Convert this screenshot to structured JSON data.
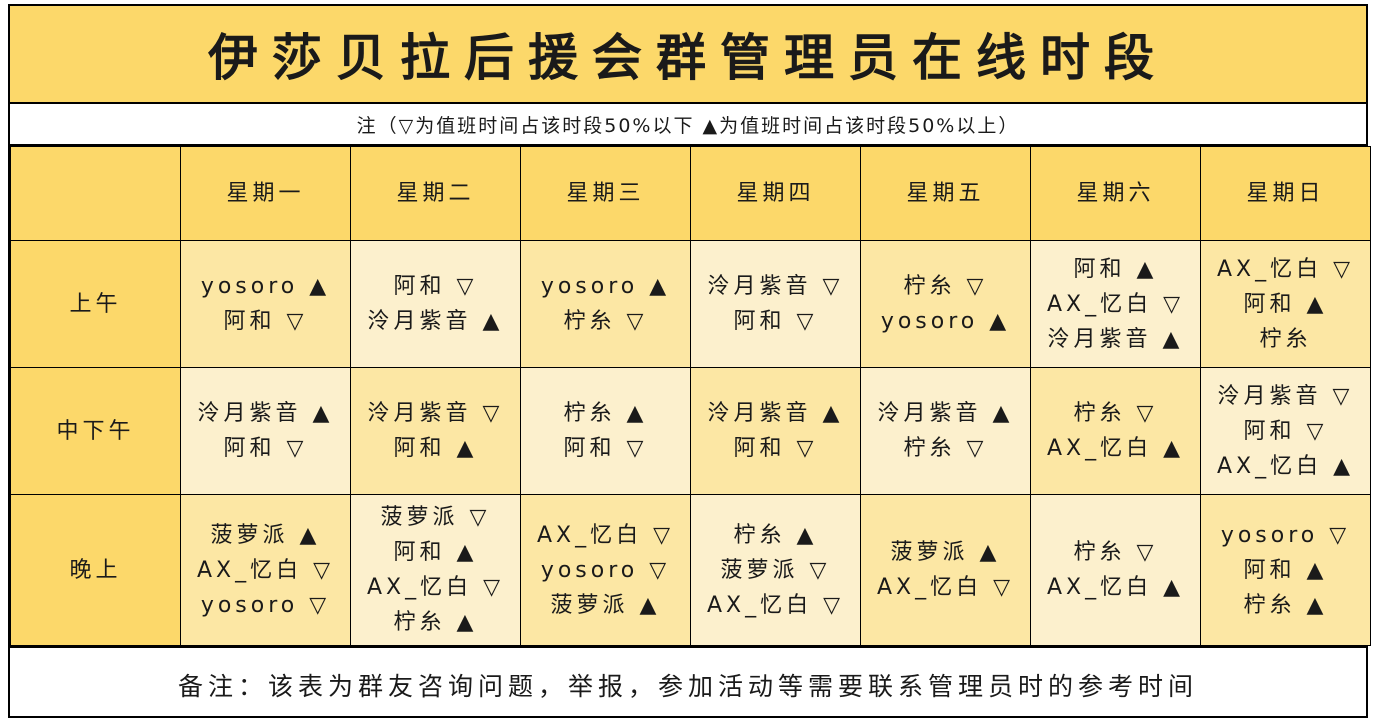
{
  "title": "伊莎贝拉后援会群管理员在线时段",
  "note": "注（▽为值班时间占该时段50%以下 ▲为值班时间占该时段50%以上）",
  "days": [
    "星期一",
    "星期二",
    "星期三",
    "星期四",
    "星期五",
    "星期六",
    "星期日"
  ],
  "periods": [
    {
      "label": "上午",
      "cells": [
        [
          "yosoro ▲",
          "阿和 ▽"
        ],
        [
          "阿和 ▽",
          "泠月紫音 ▲"
        ],
        [
          "yosoro ▲",
          "柠糸 ▽"
        ],
        [
          "泠月紫音 ▽",
          "阿和 ▽"
        ],
        [
          "柠糸 ▽",
          "yosoro ▲"
        ],
        [
          "阿和 ▲",
          "AX_忆白 ▽",
          "泠月紫音 ▲"
        ],
        [
          "AX_忆白 ▽",
          "阿和 ▲",
          "柠糸"
        ]
      ]
    },
    {
      "label": "中下午",
      "cells": [
        [
          "泠月紫音 ▲",
          "阿和 ▽"
        ],
        [
          "泠月紫音 ▽",
          "阿和 ▲"
        ],
        [
          "柠糸 ▲",
          "阿和 ▽"
        ],
        [
          "泠月紫音 ▲",
          "阿和 ▽"
        ],
        [
          "泠月紫音 ▲",
          "柠糸 ▽"
        ],
        [
          "柠糸 ▽",
          "AX_忆白 ▲"
        ],
        [
          "泠月紫音 ▽",
          "阿和 ▽",
          "AX_忆白 ▲"
        ]
      ]
    },
    {
      "label": "晚上",
      "cells": [
        [
          "菠萝派 ▲",
          "AX_忆白 ▽",
          "yosoro ▽"
        ],
        [
          "菠萝派 ▽",
          "阿和 ▲",
          "AX_忆白 ▽",
          "柠糸 ▲"
        ],
        [
          "AX_忆白 ▽",
          "yosoro ▽",
          "菠萝派 ▲"
        ],
        [
          "柠糸 ▲",
          "菠萝派 ▽",
          "AX_忆白 ▽"
        ],
        [
          "菠萝派 ▲",
          "AX_忆白 ▽"
        ],
        [
          "柠糸 ▽",
          "AX_忆白 ▲"
        ],
        [
          "yosoro ▽",
          "阿和 ▲",
          "柠糸 ▲"
        ]
      ]
    }
  ],
  "footer": "备注：该表为群友咨询问题，举报，参加活动等需要联系管理员时的参考时间",
  "colors": {
    "header_yellow": "#fcd86a",
    "cell_yellow": "#fce7a4",
    "cell_cream": "#fcf0cd"
  }
}
